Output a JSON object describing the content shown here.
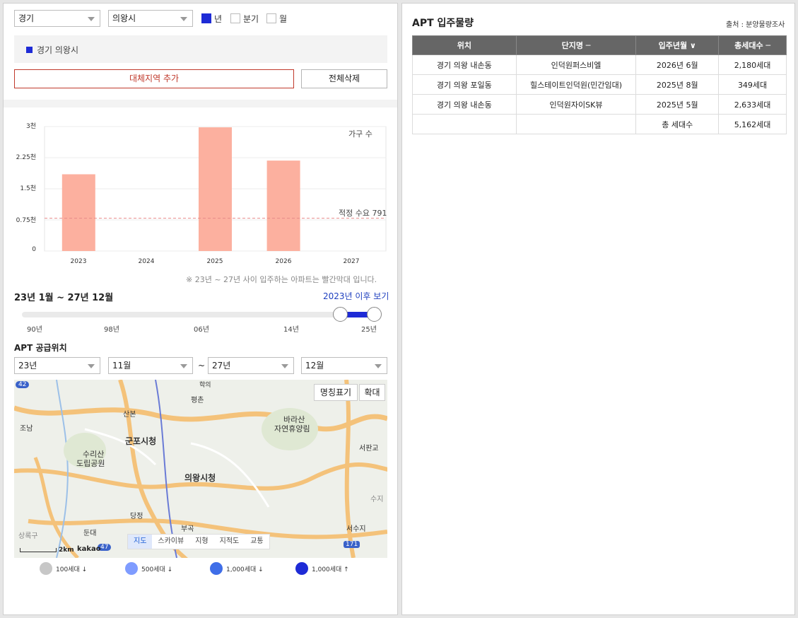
{
  "filters": {
    "province": "경기",
    "city": "의왕시",
    "period_options": [
      {
        "label": "년",
        "checked": true
      },
      {
        "label": "분기",
        "checked": false
      },
      {
        "label": "월",
        "checked": false
      }
    ]
  },
  "region": {
    "selected": "경기 의왕시"
  },
  "buttons": {
    "add_region": "대체지역 추가",
    "delete_all": "전체삭제"
  },
  "chart_data": {
    "type": "bar",
    "categories": [
      "2023",
      "2024",
      "2025",
      "2026",
      "2027"
    ],
    "series": [
      {
        "name": "가구 수",
        "values": [
          1850,
          0,
          2982,
          2180,
          0
        ]
      }
    ],
    "ytick_labels": [
      "3천",
      "2.25천",
      "1.5천",
      "0.75천",
      "0"
    ],
    "ylim": [
      0,
      3000
    ],
    "reference_line": {
      "label": "적정 수요 791",
      "value": 791
    },
    "colors": {
      "bar": "#fcb09f",
      "ref": "#e88a8a"
    },
    "grid": true
  },
  "chart_note": "※ 23년 ~ 27년 사이 입주하는 아파트는 빨간막대 입니다.",
  "range": {
    "label": "23년 1월 ~ 27년 12월",
    "link": "2023년 이후 보기",
    "ticks": [
      "90년",
      "98년",
      "06년",
      "14년",
      "25년"
    ]
  },
  "supply": {
    "title": "APT 공급위치",
    "from_year": "23년",
    "from_month": "11월",
    "tilde": "~",
    "to_year": "27년",
    "to_month": "12월"
  },
  "map": {
    "buttons": {
      "names": "명칭표기",
      "zoom": "확대"
    },
    "labels": [
      "군포시청",
      "의왕시청",
      "수리산",
      "도립공원",
      "바라산",
      "자연휴양림",
      "산본",
      "평촌",
      "조남",
      "둔대",
      "부곡",
      "서수지",
      "서판교",
      "수지",
      "상록구",
      "둔대",
      "당정",
      "학의"
    ],
    "scale": "2km",
    "brand": "kakao",
    "tabs": [
      "지도",
      "스카이뷰",
      "지형",
      "지적도",
      "교통"
    ],
    "active_tab": "지도",
    "road_badges": [
      "42",
      "47",
      "171"
    ]
  },
  "legend": [
    {
      "label": "100세대 ↓",
      "color": "#c7c7c7",
      "icon": "map-pin-icon"
    },
    {
      "label": "500세대 ↓",
      "color": "#7f9cff",
      "icon": "map-pin-icon"
    },
    {
      "label": "1,000세대 ↓",
      "color": "#3f6ee8",
      "icon": "map-pin-icon"
    },
    {
      "label": "1,000세대 ↑",
      "color": "#1e2bd6",
      "icon": "map-pin-icon"
    }
  ],
  "right": {
    "title": "APT 입주물량",
    "source": "출처 : 분양물량조사",
    "columns": [
      "위치",
      "단지명 ─",
      "입주년월 ∨",
      "총세대수 ─"
    ],
    "rows": [
      [
        "경기 의왕 내손동",
        "인덕원퍼스비엘",
        "2026년 6월",
        "2,180세대"
      ],
      [
        "경기 의왕 포일동",
        "힐스테이트인덕원(민간임대)",
        "2025년 8월",
        "349세대"
      ],
      [
        "경기 의왕 내손동",
        "인덕원자이SK뷰",
        "2025년 5월",
        "2,633세대"
      ]
    ],
    "total": {
      "label": "총 세대수",
      "value": "5,162세대"
    }
  }
}
